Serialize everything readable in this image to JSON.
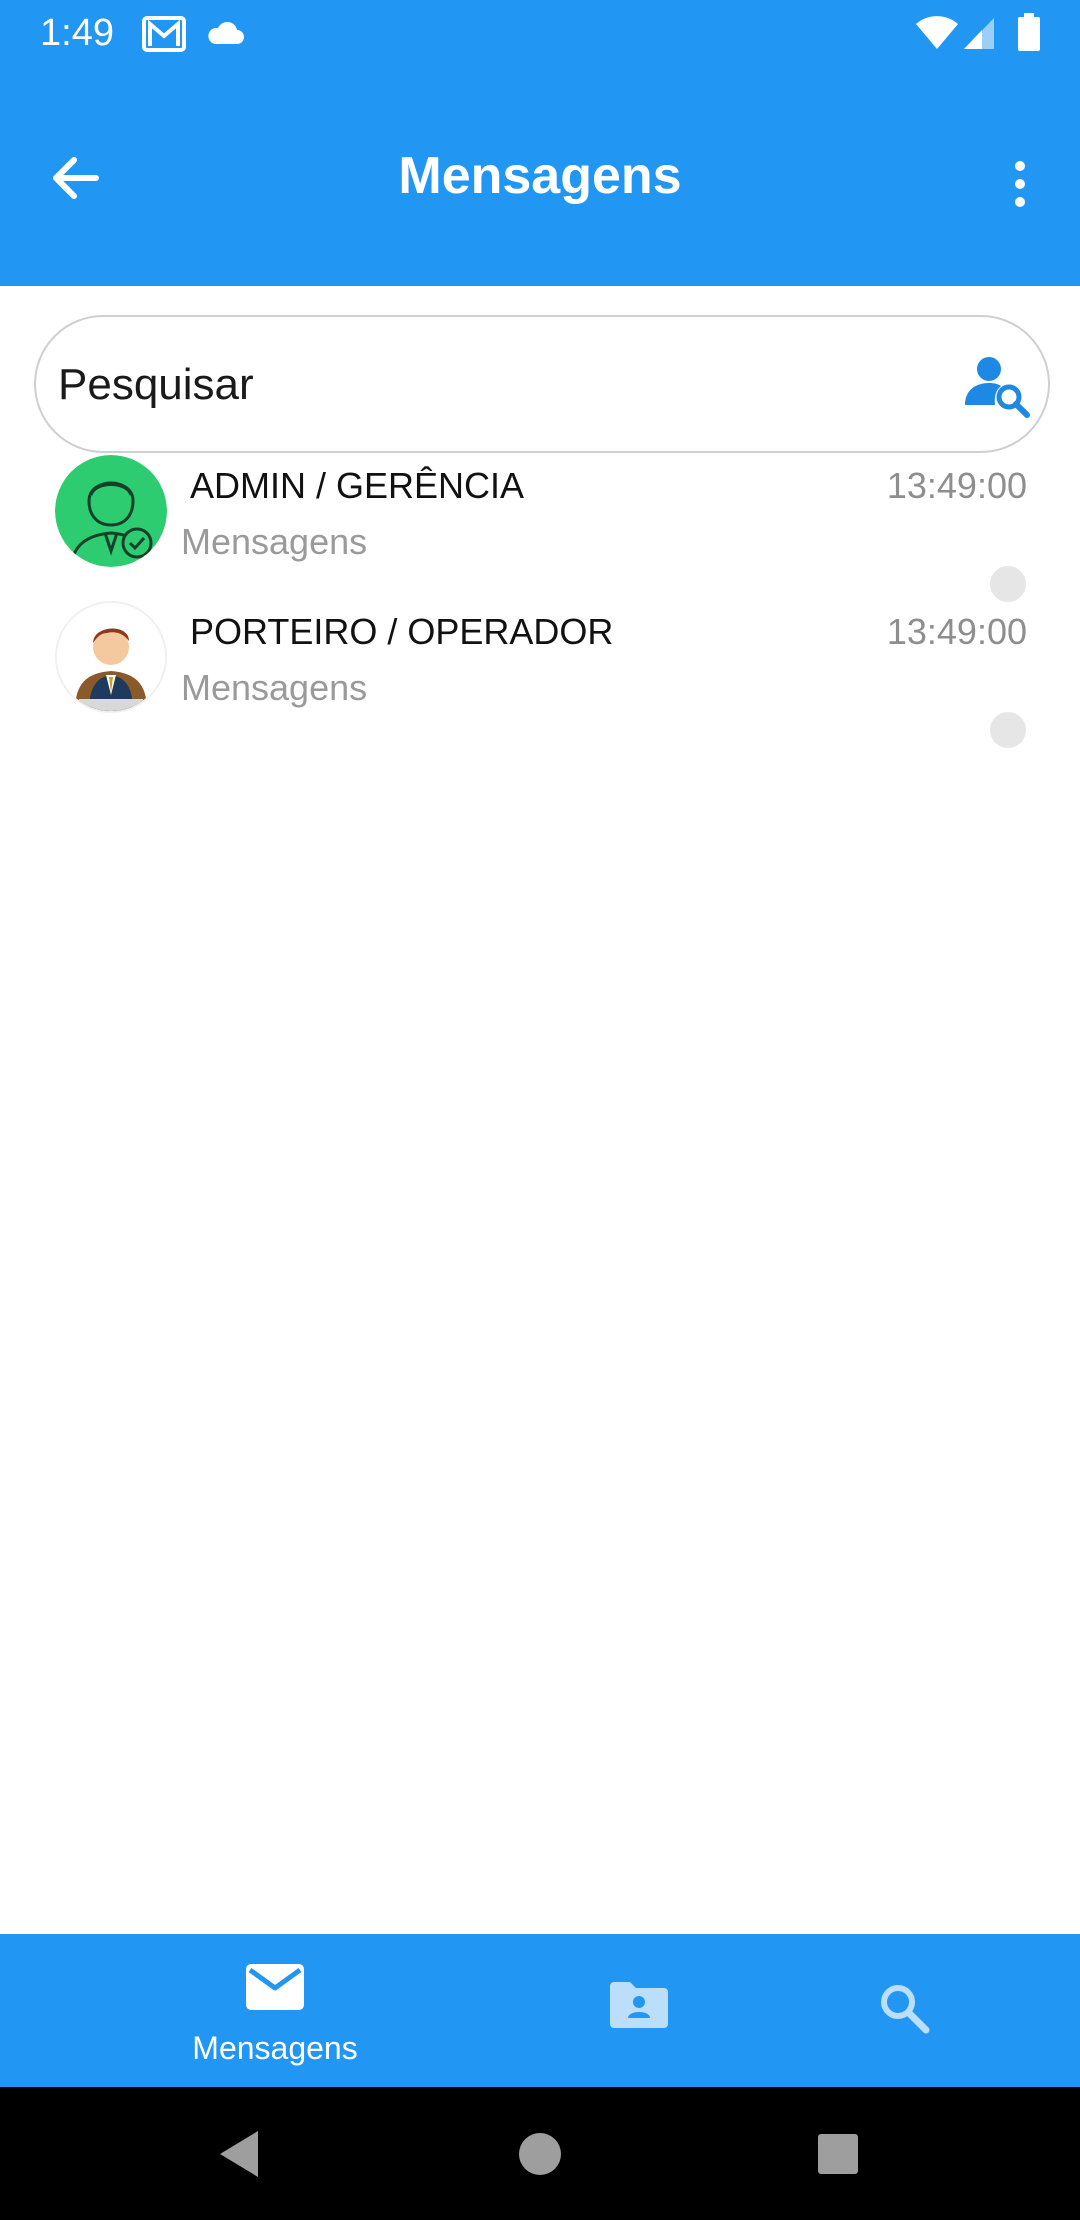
{
  "status_bar": {
    "time": "1:49",
    "icons": [
      "gmail-icon",
      "cloud-icon",
      "wifi-icon",
      "signal-icon",
      "battery-icon"
    ]
  },
  "app_bar": {
    "title": "Mensagens",
    "back_icon": "arrow-back-icon",
    "menu_icon": "more-vert-icon"
  },
  "search": {
    "placeholder": "Pesquisar",
    "value": "",
    "icon": "person-search-icon"
  },
  "chats": [
    {
      "name": "ADMIN / GERÊNCIA",
      "time": "13:49:00",
      "preview": "Mensagens",
      "avatar": "admin-avatar"
    },
    {
      "name": "PORTEIRO / OPERADOR",
      "time": "13:49:00",
      "preview": "Mensagens",
      "avatar": "doorman-avatar"
    }
  ],
  "bottom_nav": {
    "items": [
      {
        "label": "Mensagens",
        "icon": "mail-icon",
        "active": true
      },
      {
        "label": "",
        "icon": "contacts-folder-icon",
        "active": false
      },
      {
        "label": "",
        "icon": "search-icon",
        "active": false
      }
    ]
  },
  "colors": {
    "primary": "#2196F3",
    "text_primary": "#111111",
    "text_secondary": "#9a9a9a",
    "admin_avatar_bg": "#2ECC71",
    "unread_dot": "#e6e6e6"
  }
}
